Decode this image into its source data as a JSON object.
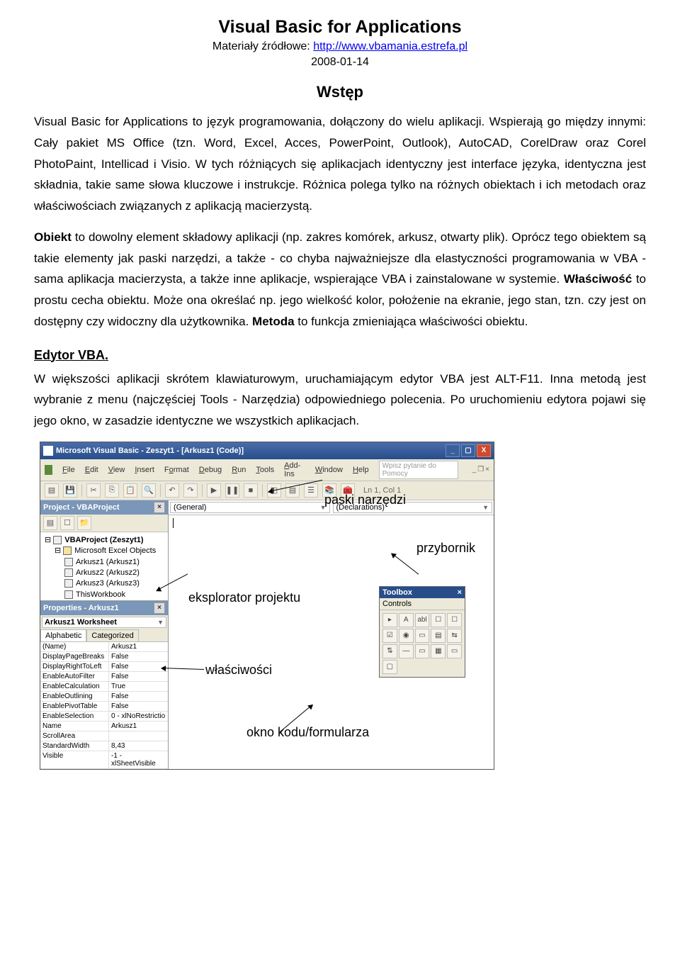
{
  "title": "Visual Basic for Applications",
  "subtitle_prefix": "Materiały źródłowe: ",
  "subtitle_link": "http://www.vbamania.estrefa.pl",
  "date": "2008-01-14",
  "section_heading": "Wstęp",
  "para1_a": "Visual Basic for Applications to język programowania, dołączony do wielu aplikacji. Wspierają go między innymi: Cały pakiet MS Office (tzn. Word, Excel, Acces, PowerPoint, Outlook), AutoCAD, CorelDraw oraz Corel PhotoPaint, Intellicad i Visio. W tych różniących się aplikacjach identyczny jest interface języka, identyczna jest składnia, takie same słowa kluczowe i instrukcje. Różnica polega tylko na różnych obiektach i ich metodach oraz właściwościach związanych z aplikacją macierzystą.",
  "para2_a": "Obiekt",
  "para2_b": " to dowolny element składowy aplikacji (np. zakres komórek, arkusz, otwarty plik). Oprócz tego obiektem są takie elementy jak paski narzędzi, a także - co chyba najważniejsze dla elastyczności programowania w VBA - sama aplikacja macierzysta, a także inne aplikacje, wspierające VBA i zainstalowane w systemie. ",
  "para2_c": "Właściwość",
  "para2_d": " to prostu cecha obiektu. Może ona określać np. jego wielkość kolor, położenie na ekranie, jego stan, tzn. czy jest on dostępny czy widoczny dla użytkownika. ",
  "para2_e": "Metoda",
  "para2_f": " to funkcja zmieniająca właściwości obiektu.",
  "sub_heading": "Edytor VBA.",
  "para3": "W większości aplikacji skrótem klawiaturowym, uruchamiającym edytor VBA jest ALT-F11. Inna metodą jest wybranie z menu (najczęściej Tools - Narzędzia) odpowiedniego polecenia. Po uruchomieniu edytora pojawi się jego okno, w zasadzie identyczne we wszystkich aplikacjach.",
  "window": {
    "title": "Microsoft Visual Basic - Zeszyt1 - [Arkusz1 (Code)]",
    "menu": [
      "File",
      "Edit",
      "View",
      "Insert",
      "Format",
      "Debug",
      "Run",
      "Tools",
      "Add-Ins",
      "Window",
      "Help"
    ],
    "help_placeholder": "Wpisz pytanie do Pomocy",
    "location": "Ln 1, Col 1",
    "project_pane_title": "Project - VBAProject",
    "project_tree": {
      "root": "VBAProject (Zeszyt1)",
      "folder": "Microsoft Excel Objects",
      "items": [
        "Arkusz1 (Arkusz1)",
        "Arkusz2 (Arkusz2)",
        "Arkusz3 (Arkusz3)",
        "ThisWorkbook"
      ]
    },
    "props_pane_title": "Properties - Arkusz1",
    "props_select": "Arkusz1 Worksheet",
    "props_tabs": [
      "Alphabetic",
      "Categorized"
    ],
    "props": [
      {
        "k": "(Name)",
        "v": "Arkusz1"
      },
      {
        "k": "DisplayPageBreaks",
        "v": "False"
      },
      {
        "k": "DisplayRightToLeft",
        "v": "False"
      },
      {
        "k": "EnableAutoFilter",
        "v": "False"
      },
      {
        "k": "EnableCalculation",
        "v": "True"
      },
      {
        "k": "EnableOutlining",
        "v": "False"
      },
      {
        "k": "EnablePivotTable",
        "v": "False"
      },
      {
        "k": "EnableSelection",
        "v": "0 - xlNoRestrictio"
      },
      {
        "k": "Name",
        "v": "Arkusz1"
      },
      {
        "k": "ScrollArea",
        "v": ""
      },
      {
        "k": "StandardWidth",
        "v": "8,43"
      },
      {
        "k": "Visible",
        "v": "-1 - xlSheetVisible"
      }
    ],
    "code_dd_left": "(General)",
    "code_dd_right": "(Declarations)",
    "toolbox_title": "Toolbox",
    "toolbox_sub": "Controls",
    "toolbox_items": [
      "▸",
      "A",
      "abl",
      "☐",
      "☐",
      "☑",
      "◉",
      "▭",
      "▤",
      "⇆",
      "⇅",
      "—",
      "▭",
      "▦",
      "▭",
      "▢"
    ]
  },
  "annotations": {
    "paski": "paski narzędzi",
    "przybornik": "przybornik",
    "eksplorator": "eksplorator projektu",
    "wlasciwosci": "właściwości",
    "okno_kodu": "okno kodu/formularza"
  }
}
